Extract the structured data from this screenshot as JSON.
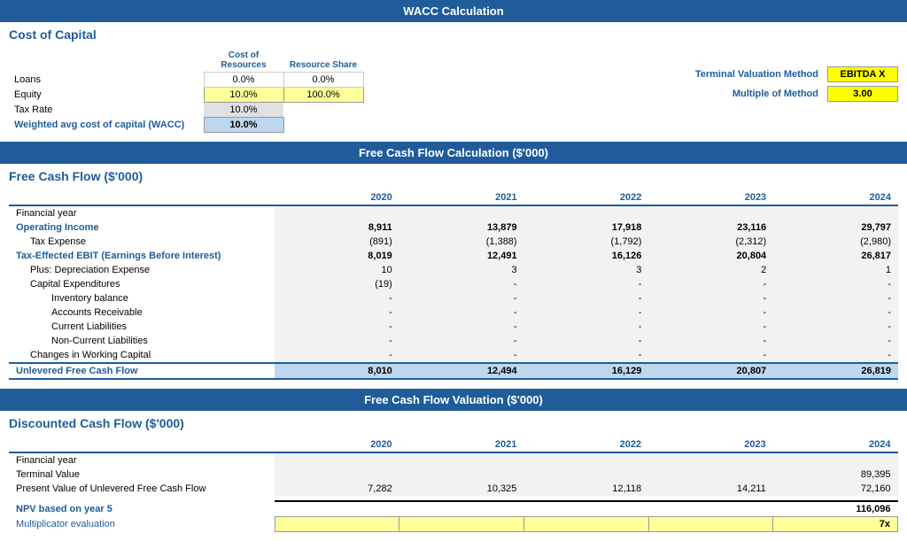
{
  "page": {
    "wacc_header": "WACC Calculation",
    "fcf_header": "Free Cash Flow Calculation ($'000)",
    "valuation_header": "Free Cash Flow Valuation ($'000)",
    "cost_of_capital": {
      "title": "Cost of Capital",
      "col1": "Cost of Resources",
      "col2": "Resource Share",
      "rows": [
        {
          "label": "Loans",
          "cost": "0.0%",
          "share": "0.0%",
          "label_bold": false
        },
        {
          "label": "Equity",
          "cost": "10.0%",
          "share": "100.0%",
          "label_bold": false
        },
        {
          "label": "Tax Rate",
          "cost": "10.0%",
          "share": "",
          "label_bold": false
        },
        {
          "label": "Weighted avg cost of capital (WACC)",
          "cost": "10.0%",
          "share": "",
          "label_bold": true
        }
      ],
      "terminal_method_label": "Terminal Valuation Method",
      "terminal_method_value": "EBITDA X",
      "multiple_label": "Multiple of Method",
      "multiple_value": "3.00"
    },
    "fcf": {
      "title": "Free Cash Flow ($'000)",
      "years": [
        "2020",
        "2021",
        "2022",
        "2023",
        "2024"
      ],
      "rows": [
        {
          "label": "Financial year",
          "indent": 0,
          "bold": false,
          "header": true,
          "values": [
            "",
            "",
            "",
            "",
            ""
          ]
        },
        {
          "label": "Operating Income",
          "indent": 0,
          "bold": true,
          "values": [
            "8,911",
            "13,879",
            "17,918",
            "23,116",
            "29,797"
          ]
        },
        {
          "label": "Tax Expense",
          "indent": 1,
          "bold": false,
          "values": [
            "(891)",
            "(1,388)",
            "(1,792)",
            "(2,312)",
            "(2,980)"
          ]
        },
        {
          "label": "Tax-Effected EBIT (Earnings Before Interest)",
          "indent": 0,
          "bold": true,
          "values": [
            "8,019",
            "12,491",
            "16,126",
            "20,804",
            "26,817"
          ]
        },
        {
          "label": "Plus: Depreciation Expense",
          "indent": 1,
          "bold": false,
          "values": [
            "10",
            "3",
            "3",
            "2",
            "1"
          ]
        },
        {
          "label": "Capital Expenditures",
          "indent": 1,
          "bold": false,
          "values": [
            "(19)",
            "-",
            "-",
            "-",
            "-"
          ]
        },
        {
          "label": "Inventory balance",
          "indent": 2,
          "bold": false,
          "values": [
            "-",
            "-",
            "-",
            "-",
            "-"
          ]
        },
        {
          "label": "Accounts Receivable",
          "indent": 2,
          "bold": false,
          "values": [
            "-",
            "-",
            "-",
            "-",
            "-"
          ]
        },
        {
          "label": "Current Liabilities",
          "indent": 2,
          "bold": false,
          "values": [
            "-",
            "-",
            "-",
            "-",
            "-"
          ]
        },
        {
          "label": "Non-Current Liabilities",
          "indent": 2,
          "bold": false,
          "values": [
            "-",
            "-",
            "-",
            "-",
            "-"
          ]
        },
        {
          "label": "Changes in Working Capital",
          "indent": 1,
          "bold": false,
          "values": [
            "-",
            "-",
            "-",
            "-",
            "-"
          ]
        },
        {
          "label": "Unlevered Free Cash Flow",
          "indent": 0,
          "bold": true,
          "ulfcf": true,
          "values": [
            "8,010",
            "12,494",
            "16,129",
            "20,807",
            "26,819"
          ]
        }
      ]
    },
    "dcf": {
      "title": "Discounted Cash Flow ($'000)",
      "years": [
        "2020",
        "2021",
        "2022",
        "2023",
        "2024"
      ],
      "rows": [
        {
          "label": "Financial year",
          "indent": 0,
          "bold": false,
          "header": true,
          "values": [
            "",
            "",
            "",
            "",
            ""
          ]
        },
        {
          "label": "Terminal Value",
          "indent": 0,
          "bold": false,
          "values": [
            "",
            "",
            "",
            "",
            "89,395"
          ]
        },
        {
          "label": "Present Value of Unlevered Free Cash Flow",
          "indent": 0,
          "bold": false,
          "values": [
            "7,282",
            "10,325",
            "12,118",
            "14,211",
            "72,160"
          ]
        },
        {
          "spacer": true
        },
        {
          "label": "NPV based on year 5",
          "indent": 0,
          "bold": true,
          "npv": true,
          "values": [
            "",
            "",
            "",
            "",
            "116,096"
          ]
        },
        {
          "label": "Multiplicator evaluation",
          "indent": 0,
          "bold": false,
          "mult": true,
          "values": [
            "",
            "",
            "",
            "",
            "7x"
          ]
        }
      ]
    }
  }
}
